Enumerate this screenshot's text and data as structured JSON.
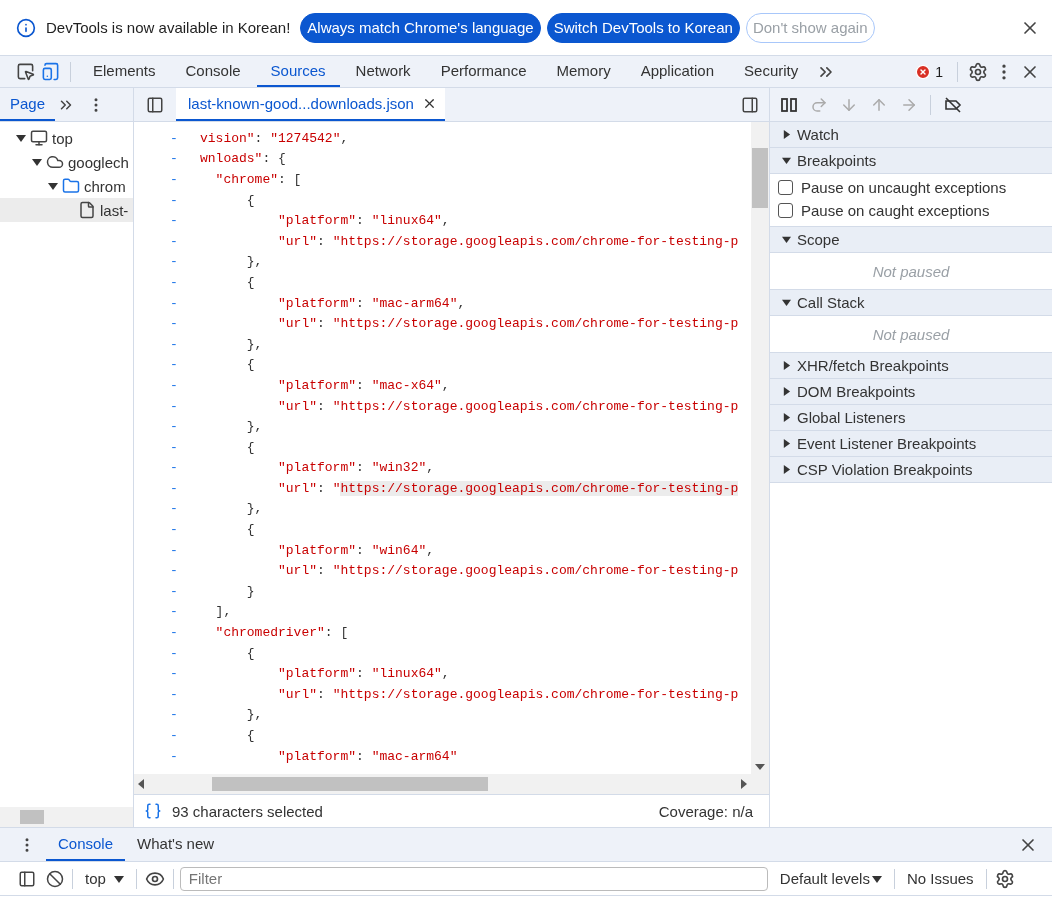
{
  "infobar": {
    "message": "DevTools is now available in Korean!",
    "buttons": [
      {
        "label": "Always match Chrome's language",
        "kind": "primary"
      },
      {
        "label": "Switch DevTools to Korean",
        "kind": "primary"
      },
      {
        "label": "Don't show again",
        "kind": "outline"
      }
    ]
  },
  "toolbar": {
    "tabs": [
      {
        "label": "Elements",
        "selected": false
      },
      {
        "label": "Console",
        "selected": false
      },
      {
        "label": "Sources",
        "selected": true
      },
      {
        "label": "Network",
        "selected": false
      },
      {
        "label": "Performance",
        "selected": false
      },
      {
        "label": "Memory",
        "selected": false
      },
      {
        "label": "Application",
        "selected": false
      },
      {
        "label": "Security",
        "selected": false
      }
    ],
    "error_count": "1"
  },
  "navigator": {
    "tabs": [
      {
        "label": "Page",
        "selected": true
      }
    ],
    "tree": [
      {
        "label": "top",
        "kind": "frame",
        "expanded": true,
        "selected": false,
        "children": [
          {
            "label": "googlech",
            "kind": "domain",
            "expanded": true,
            "selected": false,
            "children": [
              {
                "label": "chrom",
                "kind": "folder",
                "expanded": true,
                "selected": false,
                "children": [
                  {
                    "label": "last-",
                    "kind": "file",
                    "selected": true
                  }
                ]
              }
            ]
          }
        ]
      }
    ]
  },
  "editor": {
    "tabs": [
      {
        "label": "last-known-good...downloads.json",
        "selected": true
      }
    ],
    "lines": [
      {
        "marker": "-",
        "parts": [
          {
            "text": "vision\"",
            "kind": "string"
          },
          {
            "text": ": ",
            "kind": "punct"
          },
          {
            "text": "\"1274542\"",
            "kind": "string"
          },
          {
            "text": ",",
            "kind": "punct"
          }
        ]
      },
      {
        "marker": "-",
        "parts": [
          {
            "text": "wnloads\"",
            "kind": "string"
          },
          {
            "text": ": {",
            "kind": "punct"
          }
        ]
      },
      {
        "marker": "-",
        "parts": [
          {
            "text": "  \"chrome\"",
            "kind": "string"
          },
          {
            "text": ": [",
            "kind": "punct"
          }
        ]
      },
      {
        "marker": "-",
        "parts": [
          {
            "text": "      {",
            "kind": "punct"
          }
        ]
      },
      {
        "marker": "-",
        "parts": [
          {
            "text": "          \"platform\"",
            "kind": "string"
          },
          {
            "text": ": ",
            "kind": "punct"
          },
          {
            "text": "\"linux64\"",
            "kind": "string"
          },
          {
            "text": ",",
            "kind": "punct"
          }
        ]
      },
      {
        "marker": "-",
        "parts": [
          {
            "text": "          \"url\"",
            "kind": "string"
          },
          {
            "text": ": ",
            "kind": "punct"
          },
          {
            "text": "\"https://storage.googleapis.com/chrome-for-testing-p",
            "kind": "string"
          }
        ]
      },
      {
        "marker": "-",
        "parts": [
          {
            "text": "      },",
            "kind": "punct"
          }
        ]
      },
      {
        "marker": "-",
        "parts": [
          {
            "text": "      {",
            "kind": "punct"
          }
        ]
      },
      {
        "marker": "-",
        "parts": [
          {
            "text": "          \"platform\"",
            "kind": "string"
          },
          {
            "text": ": ",
            "kind": "punct"
          },
          {
            "text": "\"mac-arm64\"",
            "kind": "string"
          },
          {
            "text": ",",
            "kind": "punct"
          }
        ]
      },
      {
        "marker": "-",
        "parts": [
          {
            "text": "          \"url\"",
            "kind": "string"
          },
          {
            "text": ": ",
            "kind": "punct"
          },
          {
            "text": "\"https://storage.googleapis.com/chrome-for-testing-p",
            "kind": "string"
          }
        ]
      },
      {
        "marker": "-",
        "parts": [
          {
            "text": "      },",
            "kind": "punct"
          }
        ]
      },
      {
        "marker": "-",
        "parts": [
          {
            "text": "      {",
            "kind": "punct"
          }
        ]
      },
      {
        "marker": "-",
        "parts": [
          {
            "text": "          \"platform\"",
            "kind": "string"
          },
          {
            "text": ": ",
            "kind": "punct"
          },
          {
            "text": "\"mac-x64\"",
            "kind": "string"
          },
          {
            "text": ",",
            "kind": "punct"
          }
        ]
      },
      {
        "marker": "-",
        "parts": [
          {
            "text": "          \"url\"",
            "kind": "string"
          },
          {
            "text": ": ",
            "kind": "punct"
          },
          {
            "text": "\"https://storage.googleapis.com/chrome-for-testing-p",
            "kind": "string"
          }
        ]
      },
      {
        "marker": "-",
        "parts": [
          {
            "text": "      },",
            "kind": "punct"
          }
        ]
      },
      {
        "marker": "-",
        "parts": [
          {
            "text": "      {",
            "kind": "punct"
          }
        ]
      },
      {
        "marker": "-",
        "parts": [
          {
            "text": "          \"platform\"",
            "kind": "string"
          },
          {
            "text": ": ",
            "kind": "punct"
          },
          {
            "text": "\"win32\"",
            "kind": "string"
          },
          {
            "text": ",",
            "kind": "punct"
          }
        ]
      },
      {
        "marker": "-",
        "parts": [
          {
            "text": "          \"url\"",
            "kind": "string"
          },
          {
            "text": ": ",
            "kind": "punct"
          },
          {
            "text": "\"",
            "kind": "string"
          },
          {
            "text": "https://storage.googleapis.com/chrome-for-testing-p",
            "kind": "selected"
          }
        ]
      },
      {
        "marker": "-",
        "parts": [
          {
            "text": "      },",
            "kind": "punct"
          }
        ]
      },
      {
        "marker": "-",
        "parts": [
          {
            "text": "      {",
            "kind": "punct"
          }
        ]
      },
      {
        "marker": "-",
        "parts": [
          {
            "text": "          \"platform\"",
            "kind": "string"
          },
          {
            "text": ": ",
            "kind": "punct"
          },
          {
            "text": "\"win64\"",
            "kind": "string"
          },
          {
            "text": ",",
            "kind": "punct"
          }
        ]
      },
      {
        "marker": "-",
        "parts": [
          {
            "text": "          \"url\"",
            "kind": "string"
          },
          {
            "text": ": ",
            "kind": "punct"
          },
          {
            "text": "\"https://storage.googleapis.com/chrome-for-testing-p",
            "kind": "string"
          }
        ]
      },
      {
        "marker": "-",
        "parts": [
          {
            "text": "      }",
            "kind": "punct"
          }
        ]
      },
      {
        "marker": "-",
        "parts": [
          {
            "text": "  ],",
            "kind": "punct"
          }
        ]
      },
      {
        "marker": "-",
        "parts": [
          {
            "text": "  \"chromedriver\"",
            "kind": "string"
          },
          {
            "text": ": [",
            "kind": "punct"
          }
        ]
      },
      {
        "marker": "-",
        "parts": [
          {
            "text": "      {",
            "kind": "punct"
          }
        ]
      },
      {
        "marker": "-",
        "parts": [
          {
            "text": "          \"platform\"",
            "kind": "string"
          },
          {
            "text": ": ",
            "kind": "punct"
          },
          {
            "text": "\"linux64\"",
            "kind": "string"
          },
          {
            "text": ",",
            "kind": "punct"
          }
        ]
      },
      {
        "marker": "-",
        "parts": [
          {
            "text": "          \"url\"",
            "kind": "string"
          },
          {
            "text": ": ",
            "kind": "punct"
          },
          {
            "text": "\"https://storage.googleapis.com/chrome-for-testing-p",
            "kind": "string"
          }
        ]
      },
      {
        "marker": "-",
        "parts": [
          {
            "text": "      },",
            "kind": "punct"
          }
        ]
      },
      {
        "marker": "-",
        "parts": [
          {
            "text": "      {",
            "kind": "punct"
          }
        ]
      },
      {
        "marker": "-",
        "parts": [
          {
            "text": "          \"platform\"",
            "kind": "string"
          },
          {
            "text": ": ",
            "kind": "punct"
          },
          {
            "text": "\"mac-arm64\"",
            "kind": "string"
          }
        ]
      }
    ],
    "status": {
      "selection": "93 characters selected",
      "coverage": "Coverage: n/a"
    }
  },
  "debugger": {
    "sections": [
      {
        "title": "Watch",
        "expanded": false
      },
      {
        "title": "Breakpoints",
        "expanded": true,
        "kind": "checkboxes",
        "items": [
          {
            "label": "Pause on uncaught exceptions",
            "checked": false
          },
          {
            "label": "Pause on caught exceptions",
            "checked": false
          }
        ]
      },
      {
        "title": "Scope",
        "expanded": true,
        "kind": "message",
        "message": "Not paused"
      },
      {
        "title": "Call Stack",
        "expanded": true,
        "kind": "message",
        "message": "Not paused"
      },
      {
        "title": "XHR/fetch Breakpoints",
        "expanded": false
      },
      {
        "title": "DOM Breakpoints",
        "expanded": false
      },
      {
        "title": "Global Listeners",
        "expanded": false
      },
      {
        "title": "Event Listener Breakpoints",
        "expanded": false
      },
      {
        "title": "CSP Violation Breakpoints",
        "expanded": false
      }
    ]
  },
  "drawer": {
    "tabs": [
      {
        "label": "Console",
        "selected": true
      },
      {
        "label": "What's new",
        "selected": false
      }
    ],
    "context": "top",
    "filter": {
      "placeholder": "Filter"
    },
    "levels": "Default levels",
    "issues": "No Issues"
  }
}
